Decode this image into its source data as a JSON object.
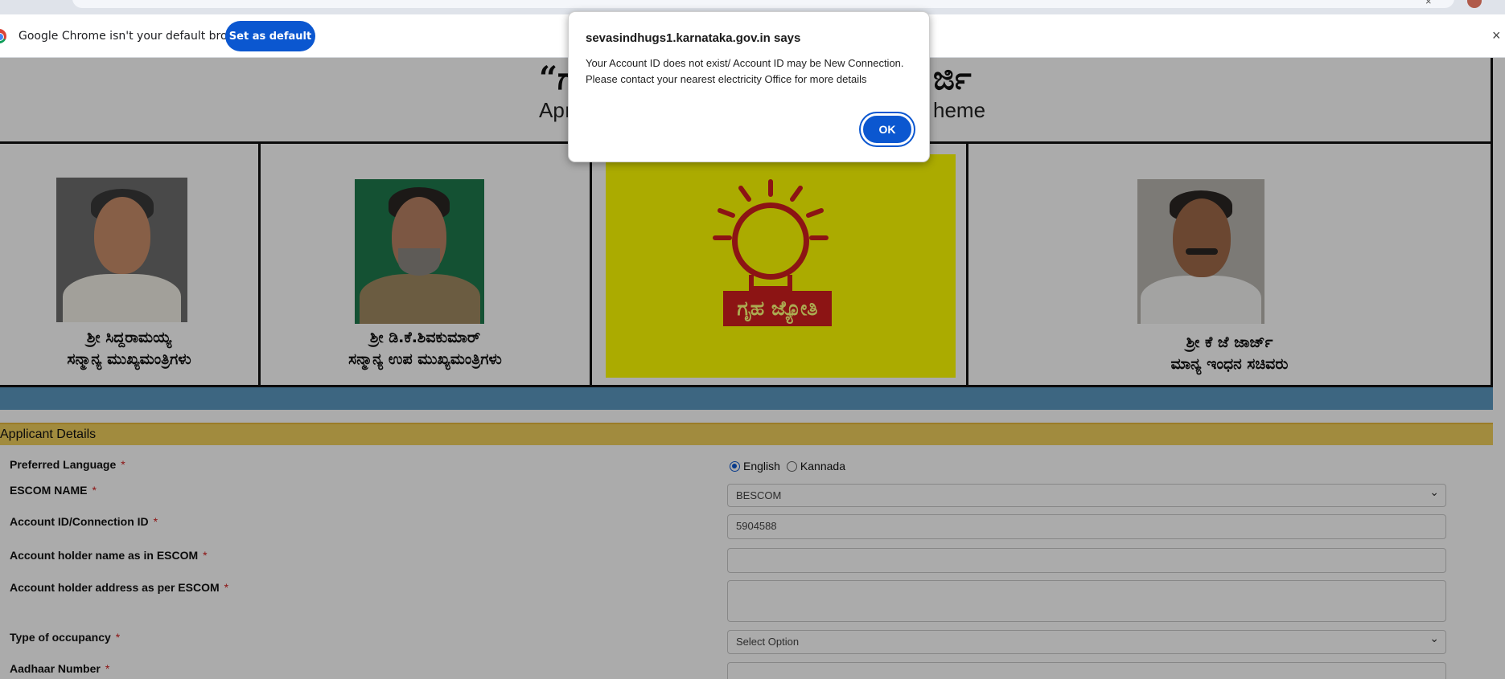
{
  "browser": {
    "infobar": {
      "message": "Google Chrome isn't your default browser",
      "set_default_label": "Set as default",
      "close_glyph": "×"
    }
  },
  "dialog": {
    "title": "sevasindhugs1.karnataka.gov.in says",
    "message": "Your Account ID does not exist/ Account ID may be New Connection. Please contact your nearest electricity Office for more details",
    "ok_label": "OK"
  },
  "header": {
    "title_left": "“ಗ",
    "title_right": "ರ್ಜಿ",
    "subtitle_left": "Apı",
    "subtitle_right": "heme"
  },
  "portraits": [
    {
      "line1": "ಶ್ರೀ ಸಿದ್ದರಾಮಯ್ಯ",
      "line2": "ಸನ್ಮಾನ್ಯ ಮುಖ್ಯಮಂತ್ರಿಗಳು"
    },
    {
      "line1": "ಶ್ರೀ ಡಿ.ಕೆ.ಶಿವಕುಮಾರ್",
      "line2": "ಸನ್ಮಾನ್ಯ ಉಪ ಮುಖ್ಯಮಂತ್ರಿಗಳು"
    },
    {
      "logo_text": "ಗೃಹ ಜ್ಯೋತಿ"
    },
    {
      "line1": "ಶ್ರೀ ಕೆ ಜೆ ಜಾರ್ಜ್",
      "line2": "ಮಾನ್ಯ ಇಂಧನ ಸಚಿವರು"
    }
  ],
  "form": {
    "section_title": "Applicant Details",
    "required_mark": "*",
    "labels": {
      "language": "Preferred Language",
      "escom": "ESCOM NAME",
      "account_id": "Account ID/Connection ID",
      "holder_name": "Account holder name as in ESCOM",
      "holder_address": "Account holder address as per ESCOM",
      "occupancy": "Type of occupancy",
      "aadhaar": "Aadhaar Number"
    },
    "language_options": [
      "English",
      "Kannada"
    ],
    "escom_value": "BESCOM",
    "account_id_value": "5904588",
    "holder_name_value": "",
    "holder_address_value": "",
    "occupancy_value": "Select Option",
    "aadhaar_value": ""
  }
}
